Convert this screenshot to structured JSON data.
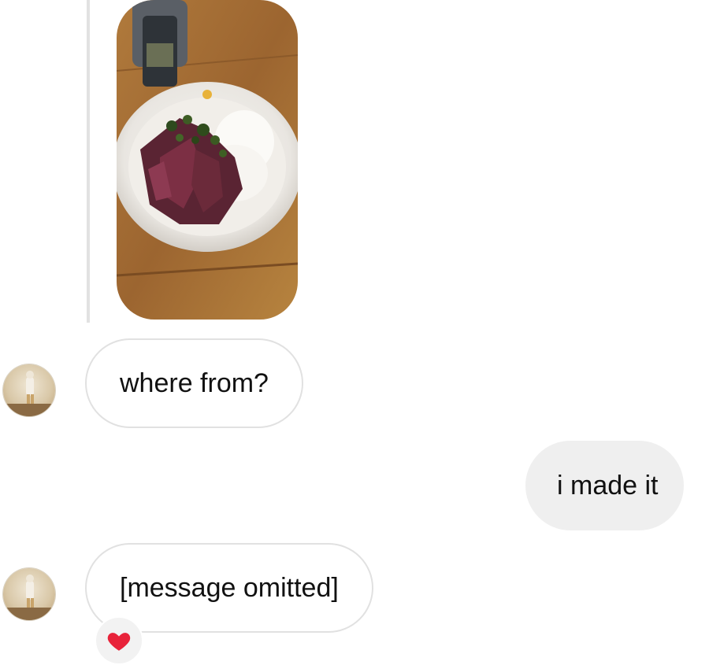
{
  "messages": [
    {
      "sender": "them",
      "type": "image",
      "subject": "plate of sliced steak with herbs over rice"
    },
    {
      "sender": "them",
      "type": "text",
      "text": "where from?"
    },
    {
      "sender": "me",
      "type": "text",
      "text": "i made it"
    },
    {
      "sender": "them",
      "type": "text",
      "text": "[message omitted]",
      "reaction": "heart"
    }
  ],
  "icons": {
    "reaction": "heart-icon",
    "avatar": "user-avatar"
  },
  "colors": {
    "incoming_bubble_border": "#e1e1e1",
    "outgoing_bubble": "#efefef",
    "heart": "#e8233a",
    "reply_bar": "#e2e2e2"
  }
}
